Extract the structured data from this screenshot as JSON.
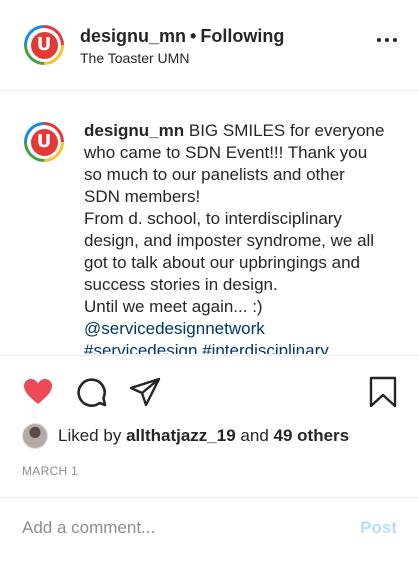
{
  "header": {
    "username": "designu_mn",
    "separator": "•",
    "follow_status": "Following",
    "location": "The Toaster UMN",
    "avatar_letter": "U"
  },
  "caption": {
    "username": "designu_mn",
    "lines": [
      "BIG SMILES for everyone",
      "who came to SDN Event!!! Thank you",
      "so much to our panelists and other",
      "SDN members!",
      "From d. school, to interdisciplinary",
      "design, and imposter syndrome, we all",
      "got to talk about our upbringings and",
      "success stories in design.",
      "Until we meet again... :)"
    ],
    "mentions": [
      "@servicedesignnetwork",
      "#servicedesign #interdisciplinary"
    ]
  },
  "actions": {
    "icons": [
      "heart-icon",
      "comment-icon",
      "share-icon",
      "bookmark-icon"
    ],
    "heart_color": "#ed4956"
  },
  "likes": {
    "prefix": "Liked by",
    "user": "allthatjazz_19",
    "conjunction": "and",
    "others": "49 others"
  },
  "date": "MARCH 1",
  "comment": {
    "placeholder": "Add a comment...",
    "post_label": "Post"
  },
  "colors": {
    "text": "#262626",
    "link": "#00376b",
    "muted": "#8e8e8e",
    "post_disabled": "#b2dffc"
  }
}
